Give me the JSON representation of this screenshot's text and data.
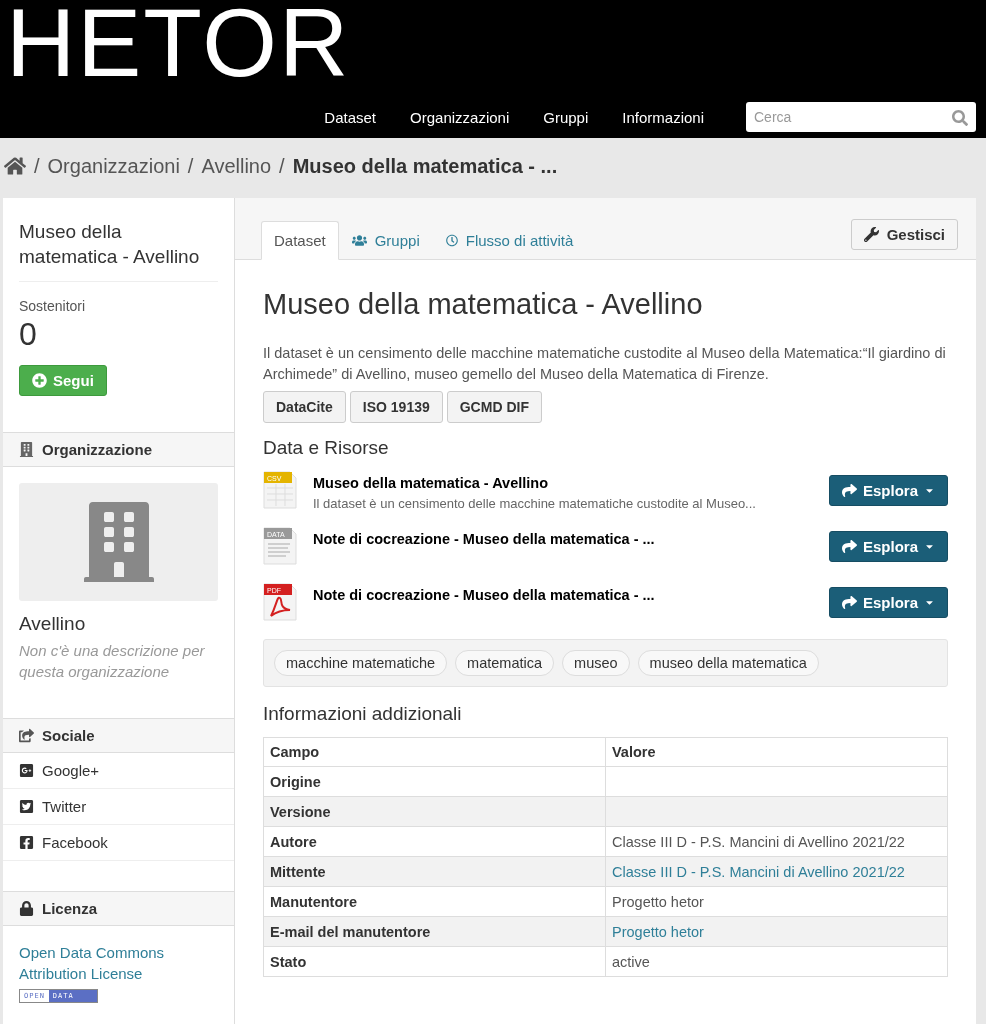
{
  "header": {
    "logo": "HETOR",
    "nav": [
      "Dataset",
      "Organizzazioni",
      "Gruppi",
      "Informazioni"
    ],
    "search": {
      "placeholder": "Cerca"
    }
  },
  "breadcrumb": {
    "separator": "/",
    "items": [
      "Organizzazioni",
      "Avellino",
      "Museo della matematica - ..."
    ]
  },
  "sidebar": {
    "title": "Museo della matematica - Avellino",
    "followers_label": "Sostenitori",
    "followers": "0",
    "follow_button": "Segui",
    "organization": {
      "heading": "Organizzazione",
      "name": "Avellino",
      "description": "Non c'è una descrizione per questa organizzazione"
    },
    "social": {
      "heading": "Sociale",
      "items": [
        {
          "kind": "google",
          "label": "Google+"
        },
        {
          "kind": "twitter",
          "label": "Twitter"
        },
        {
          "kind": "facebook",
          "label": "Facebook"
        }
      ]
    },
    "license": {
      "heading": "Licenza",
      "link": "Open Data Commons Attribution License",
      "badge": [
        "OPEN",
        "DATA"
      ]
    }
  },
  "tabs": [
    {
      "label": "Dataset",
      "kind": "plain",
      "selected": true
    },
    {
      "label": "Gruppi",
      "kind": "users",
      "selected": false
    },
    {
      "label": "Flusso di attività",
      "kind": "clock",
      "selected": false
    }
  ],
  "manage_button": "Gestisci",
  "dataset": {
    "title": "Museo della matematica - Avellino",
    "description": "Il dataset è un censimento delle macchine matematiche custodite al Museo della Matematica:“Il giardino di Archimede” di Avellino, museo gemello del Museo della Matematica di Firenze.",
    "exports": [
      "DataCite",
      "ISO 19139",
      "GCMD DIF"
    ],
    "resources_heading": "Data e Risorse",
    "resources": [
      {
        "kind": "csv",
        "format_label": "CSV",
        "title": "Museo della matematica - Avellino",
        "description": "Il dataset è un censimento delle macchine matematiche custodite al Museo...",
        "button": "Esplora"
      },
      {
        "kind": "data",
        "format_label": "DATA",
        "title": "Note di cocreazione - Museo della matematica - ...",
        "button": "Esplora"
      },
      {
        "kind": "pdf",
        "format_label": "PDF",
        "title": "Note di cocreazione - Museo della matematica - ...",
        "button": "Esplora"
      }
    ],
    "tags": [
      "macchine matematiche",
      "matematica",
      "museo",
      "museo della matematica"
    ],
    "additional_heading": "Informazioni addizionali",
    "table": {
      "columns": [
        "Campo",
        "Valore"
      ],
      "rows": [
        {
          "field": "Origine"
        },
        {
          "field": "Versione"
        },
        {
          "field": "Autore",
          "value": "Classe III D - P.S. Mancini di Avellino 2021/22",
          "link": false
        },
        {
          "field": "Mittente",
          "value": "Classe III D - P.S. Mancini di Avellino 2021/22",
          "link": true
        },
        {
          "field": "Manutentore",
          "value": "Progetto hetor",
          "link": false
        },
        {
          "field": "E-mail del manutentore",
          "value": "Progetto hetor",
          "link": true
        },
        {
          "field": "Stato",
          "value": "active",
          "link": false
        }
      ]
    }
  }
}
